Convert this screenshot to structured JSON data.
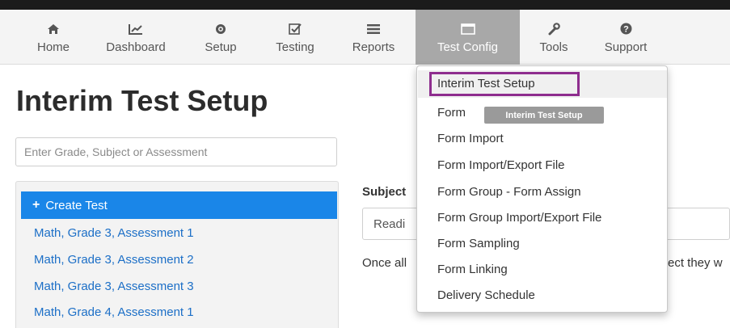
{
  "nav": {
    "items": [
      {
        "label": "Home",
        "icon": "home-icon"
      },
      {
        "label": "Dashboard",
        "icon": "chart-line-icon"
      },
      {
        "label": "Setup",
        "icon": "gear-icon"
      },
      {
        "label": "Testing",
        "icon": "checkbox-icon"
      },
      {
        "label": "Reports",
        "icon": "list-icon"
      },
      {
        "label": "Test Config",
        "icon": "window-icon",
        "active": true
      },
      {
        "label": "Tools",
        "icon": "wrench-icon"
      },
      {
        "label": "Support",
        "icon": "question-circle-icon"
      }
    ]
  },
  "page": {
    "title": "Interim Test Setup",
    "search_placeholder": "Enter Grade, Subject or Assessment"
  },
  "sidebar": {
    "create_label": "Create Test",
    "items": [
      "Math, Grade 3, Assessment 1",
      "Math, Grade 3, Assessment 2",
      "Math, Grade 3, Assessment 3",
      "Math, Grade 4, Assessment 1"
    ]
  },
  "main": {
    "subject_label": "Subject",
    "subject_value": "Readi",
    "info_text_start": "Once all",
    "info_text_end": "ect they w"
  },
  "dropdown": {
    "items": [
      "Interim Test Setup",
      "Form",
      "Form Import",
      "Form Import/Export File",
      "Form Group - Form Assign",
      "Form Group Import/Export File",
      "Form Sampling",
      "Form Linking",
      "Delivery Schedule"
    ],
    "tooltip": "Interim Test Setup"
  },
  "colors": {
    "primary": "#1a86e8",
    "active_nav": "#a8a8a8",
    "highlight_border": "#8e2d8e",
    "link": "#1c6fc7"
  }
}
